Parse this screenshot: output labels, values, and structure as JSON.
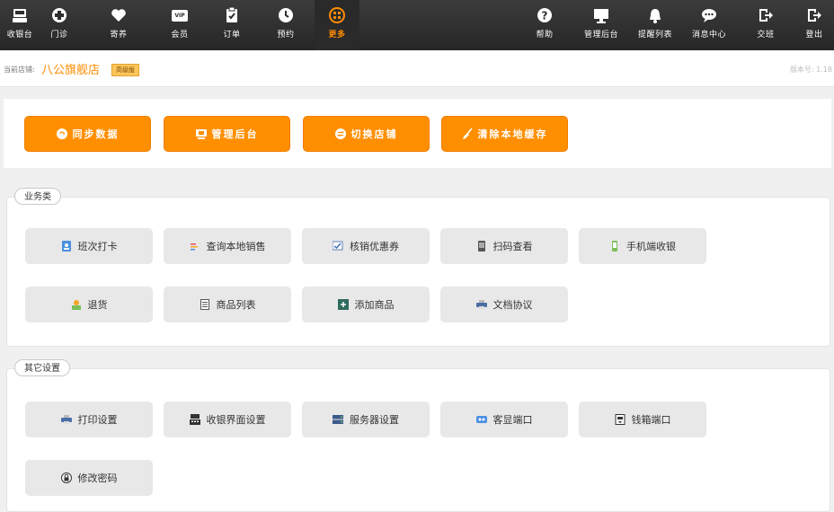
{
  "nav_left": [
    {
      "id": "cashier",
      "label": "收银台"
    },
    {
      "id": "clinic",
      "label": "门诊"
    },
    {
      "id": "boarding",
      "label": "寄养"
    },
    {
      "id": "member",
      "label": "会员",
      "icon_text": "VIP"
    },
    {
      "id": "orders",
      "label": "订单"
    },
    {
      "id": "booking",
      "label": "预约"
    },
    {
      "id": "more",
      "label": "更多"
    }
  ],
  "nav_right": [
    {
      "id": "help",
      "label": "帮助"
    },
    {
      "id": "admin",
      "label": "管理后台"
    },
    {
      "id": "reminders",
      "label": "提醒列表"
    },
    {
      "id": "messages",
      "label": "消息中心"
    },
    {
      "id": "shift",
      "label": "交班"
    },
    {
      "id": "logout",
      "label": "登出"
    }
  ],
  "store": {
    "label": "当前店铺:",
    "name": "八公旗舰店",
    "tier": "高级版",
    "version": "版本号: 1.18"
  },
  "quick_actions": [
    {
      "id": "sync",
      "label": "同步数据"
    },
    {
      "id": "admin",
      "label": "管理后台"
    },
    {
      "id": "switch",
      "label": "切换店铺"
    },
    {
      "id": "clear",
      "label": "清除本地缓存"
    }
  ],
  "business": {
    "title": "业务类",
    "items": [
      {
        "id": "shift-checkin",
        "label": "班次打卡"
      },
      {
        "id": "local-sales",
        "label": "查询本地销售"
      },
      {
        "id": "redeem-coupon",
        "label": "核销优惠券"
      },
      {
        "id": "scan-view",
        "label": "扫码查看"
      },
      {
        "id": "mobile-cashier",
        "label": "手机端收银"
      },
      {
        "id": "return",
        "label": "退货"
      },
      {
        "id": "product-list",
        "label": "商品列表"
      },
      {
        "id": "add-product",
        "label": "添加商品"
      },
      {
        "id": "doc-agreement",
        "label": "文档协议"
      }
    ]
  },
  "other": {
    "title": "其它设置",
    "items": [
      {
        "id": "print-settings",
        "label": "打印设置"
      },
      {
        "id": "cashier-ui",
        "label": "收银界面设置"
      },
      {
        "id": "server-settings",
        "label": "服务器设置"
      },
      {
        "id": "customer-display",
        "label": "客显端口"
      },
      {
        "id": "cash-drawer",
        "label": "钱箱端口"
      },
      {
        "id": "change-password",
        "label": "修改密码"
      }
    ]
  },
  "colors": {
    "accent": "#ff8f00",
    "topbar": "#2e2e2e",
    "button_gray": "#e8e8e8"
  }
}
